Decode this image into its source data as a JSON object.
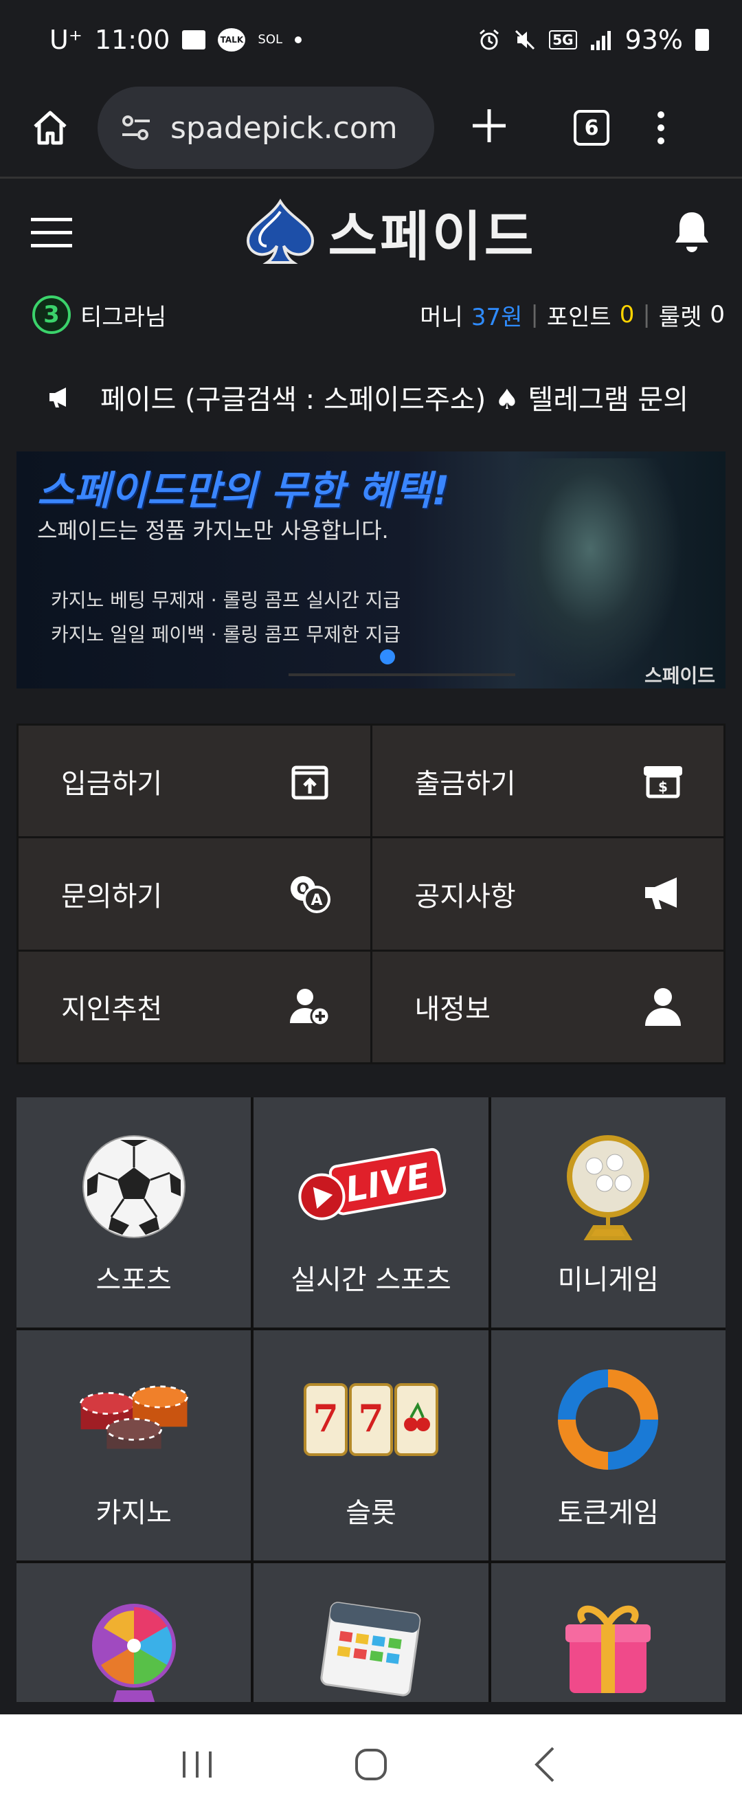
{
  "status": {
    "carrier": "U⁺",
    "time": "11:00",
    "talk": "TALK",
    "bank": "SOL",
    "network": "5G",
    "battery": "93%"
  },
  "browser": {
    "url": "spadepick.com",
    "tab_count": "6"
  },
  "site": {
    "logo_text": "스페이드"
  },
  "user": {
    "level": "3",
    "name": "티그라님",
    "money_label": "머니",
    "money_value": "37원",
    "point_label": "포인트",
    "point_value": "0",
    "roulette_label": "룰렛",
    "roulette_value": "0"
  },
  "ticker": {
    "text": "페이드 (구글검색 : 스페이드주소) ♠ 텔레그램 문의"
  },
  "banner": {
    "title": "스페이드만의 무한 혜택!",
    "subtitle": "스페이드는 정품 카지노만 사용합니다.",
    "line1": "카지노 베팅 무제재 · 롤링 콤프 실시간 지급",
    "line2": "카지노 일일 페이백 · 롤링 콤프 무제한 지급",
    "brand": "스페이드"
  },
  "actions": [
    {
      "label": "입금하기",
      "icon": "deposit-icon"
    },
    {
      "label": "출금하기",
      "icon": "withdraw-icon"
    },
    {
      "label": "문의하기",
      "icon": "qa-icon"
    },
    {
      "label": "공지사항",
      "icon": "megaphone-icon"
    },
    {
      "label": "지인추천",
      "icon": "add-user-icon"
    },
    {
      "label": "내정보",
      "icon": "user-icon"
    }
  ],
  "games": [
    {
      "label": "스포츠",
      "icon": "soccer-ball-icon"
    },
    {
      "label": "실시간 스포츠",
      "icon": "live-icon"
    },
    {
      "label": "미니게임",
      "icon": "lottery-globe-icon"
    },
    {
      "label": "카지노",
      "icon": "casino-chips-icon"
    },
    {
      "label": "슬롯",
      "icon": "slot-machine-icon"
    },
    {
      "label": "토큰게임",
      "icon": "token-ring-icon"
    },
    {
      "label": "",
      "icon": "roulette-wheel-icon"
    },
    {
      "label": "",
      "icon": "calendar-icon"
    },
    {
      "label": "",
      "icon": "gift-box-icon"
    }
  ],
  "live_badge": "LIVE",
  "colors": {
    "money": "#2f8cff",
    "point": "#ffd400",
    "level_badge": "#3bd36b"
  }
}
